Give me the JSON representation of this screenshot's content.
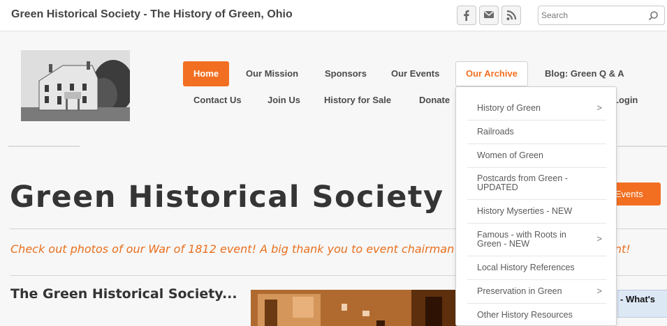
{
  "header": {
    "site_title": "Green Historical Society - The History of Green, Ohio",
    "social": [
      "facebook-icon",
      "mail-icon",
      "rss-icon"
    ],
    "search_placeholder": "Search"
  },
  "nav": {
    "row1": [
      "Home",
      "Our Mission",
      "Sponsors",
      "Our Events",
      "Our Archive",
      "Blog: Green Q & A"
    ],
    "row2": [
      "Contact Us",
      "Join Us",
      "History for Sale",
      "Donate",
      "Login"
    ],
    "active": "Home",
    "open": "Our Archive"
  },
  "dropdown": {
    "items": [
      {
        "label": "History of Green",
        "arrow": ">"
      },
      {
        "label": "Railroads",
        "arrow": ""
      },
      {
        "label": "Women of Green",
        "arrow": ""
      },
      {
        "label": "Postcards from Green - UPDATED",
        "arrow": ""
      },
      {
        "label": "History Myserties - NEW",
        "arrow": ""
      },
      {
        "label": "Famous - with Roots in Green - NEW",
        "arrow": ">"
      },
      {
        "label": "Local History References",
        "arrow": ""
      },
      {
        "label": "Preservation in Green",
        "arrow": ">"
      },
      {
        "label": "Other History Resources",
        "arrow": ""
      }
    ]
  },
  "main": {
    "page_title": "Green Historical Society",
    "events_button": "g Events",
    "announcement": "Check out photos of our War of 1812 event!  A big thank you to event chairman",
    "announcement_tail": "ent!",
    "section_title": "The Green Historical Society...",
    "side_box": " - What's"
  },
  "colors": {
    "accent": "#f26f21",
    "announcement": "#e8701f"
  }
}
